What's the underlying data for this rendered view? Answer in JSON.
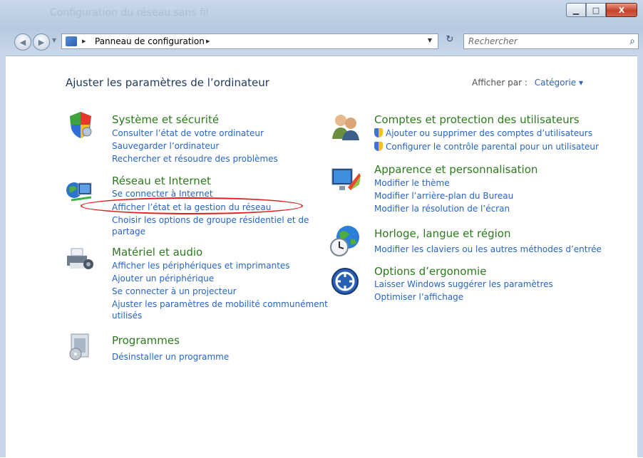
{
  "window": {
    "ghost_title": "Configuration du réseau sans fil",
    "btn_min": "▁",
    "btn_max": "□",
    "btn_close": "X"
  },
  "toolbar": {
    "back_glyph": "◀",
    "fwd_glyph": "▶",
    "address_path": "Panneau de configuration",
    "address_sep1": "▸",
    "address_sep2": "▸",
    "address_dd": "▼",
    "refresh_glyph": "↻",
    "search_placeholder": "Rechercher",
    "search_glyph": "⌕"
  },
  "header": {
    "title": "Ajuster les paramètres de l’ordinateur",
    "view_by_label": "Afficher par :",
    "view_by_value": "Catégorie ▾"
  },
  "left": [
    {
      "title": "Système et sécurité",
      "links": [
        "Consulter l’état de votre ordinateur",
        "Sauvegarder l’ordinateur",
        "Rechercher et résoudre des problèmes"
      ]
    },
    {
      "title": "Réseau et Internet",
      "links": [
        "Se connecter à Internet",
        "Afficher l’état et la gestion du réseau",
        "Choisir les options de groupe résidentiel et de",
        "partage"
      ]
    },
    {
      "title": "Matériel et audio",
      "links": [
        "Afficher les périphériques et imprimantes",
        "Ajouter un périphérique",
        "Se connecter à un projecteur",
        "Ajuster les paramètres de mobilité communément",
        "utilisés"
      ]
    },
    {
      "title": "Programmes",
      "links": [
        "Désinstaller un programme"
      ]
    }
  ],
  "right": [
    {
      "title": "Comptes et protection des utilisateurs",
      "links": [
        "Ajouter ou supprimer des comptes d’utilisateurs",
        "Configurer le contrôle parental pour un utilisateur"
      ]
    },
    {
      "title": "Apparence et personnalisation",
      "links": [
        "Modifier le thème",
        "Modifier l’arrière-plan du Bureau",
        "Modifier la résolution de l’écran"
      ]
    },
    {
      "title": "Horloge, langue et région",
      "links": [
        "Modifier les claviers ou les autres méthodes d’entrée"
      ]
    },
    {
      "title": "Options d’ergonomie",
      "links": [
        "Laisser Windows suggérer les paramètres",
        "Optimiser l’affichage"
      ]
    }
  ],
  "colors": {
    "category_title": "#2c7a1d",
    "link": "#2765c0",
    "highlight_ellipse": "#e0201e"
  }
}
